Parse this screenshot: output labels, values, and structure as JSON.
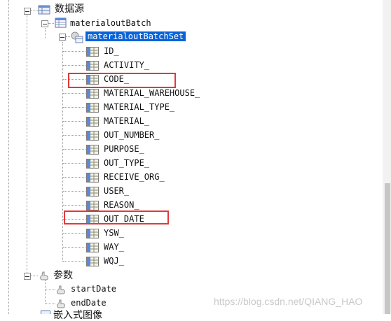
{
  "tree": {
    "datasource_label": "数据源",
    "dataset_label": "materialoutBatch",
    "selected_node_label": "materialoutBatchSet",
    "fields": [
      "ID_",
      "ACTIVITY_",
      "CODE_",
      "MATERIAL_WAREHOUSE_",
      "MATERIAL_TYPE_",
      "MATERIAL_",
      "OUT_NUMBER_",
      "PURPOSE_",
      "OUT_TYPE_",
      "RECEIVE_ORG_",
      "USER_",
      "REASON_",
      "OUT_DATE",
      "YSW_",
      "WAY_",
      "WQJ_"
    ],
    "params_label": "参数",
    "params": [
      "startDate",
      "endDate"
    ],
    "partial_bottom_label": "嵌入式图像"
  },
  "highlighted_fields": [
    "CODE_",
    "OUT_DATE"
  ],
  "watermark": "https://blog.csdn.net/QIANG_HAO",
  "colors": {
    "selection": "#0a64d8",
    "highlight_box": "#e03a3a"
  }
}
